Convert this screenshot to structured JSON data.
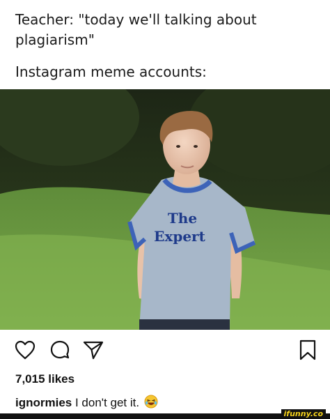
{
  "caption": {
    "line1": "Teacher: \"today we'll talking about plagiarism\"",
    "line2": "Instagram meme accounts:"
  },
  "photo": {
    "shirt_text_line1": "The",
    "shirt_text_line2": "Expert"
  },
  "actions": {
    "like_icon": "heart-icon",
    "comment_icon": "comment-icon",
    "share_icon": "send-icon",
    "save_icon": "bookmark-icon"
  },
  "post": {
    "likes": "7,015 likes",
    "comment_user": "ignormies",
    "comment_text": "I don't get it."
  },
  "watermark": {
    "text": "ifunny.co",
    "color": "#f5d21b"
  }
}
